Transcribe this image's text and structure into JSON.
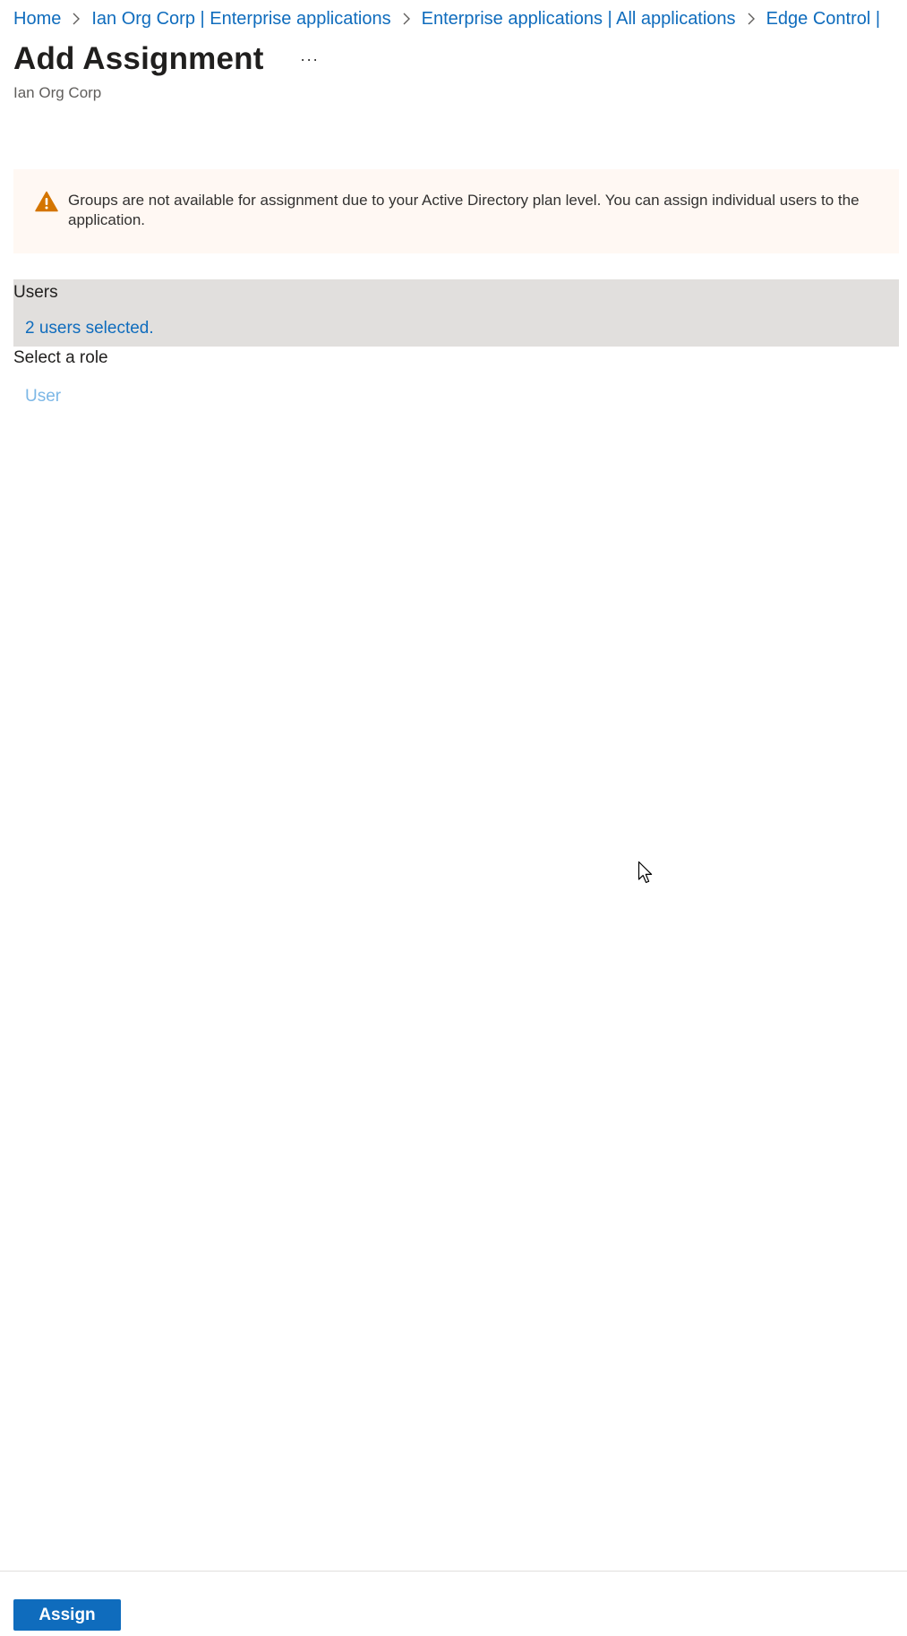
{
  "breadcrumb": {
    "items": [
      "Home",
      "Ian Org Corp | Enterprise applications",
      "Enterprise applications | All applications",
      "Edge Control |"
    ]
  },
  "header": {
    "title": "Add Assignment",
    "more_label": "···",
    "subtitle": "Ian Org Corp"
  },
  "warning": {
    "icon": "warning-triangle-icon",
    "color": "#d47500",
    "text": "Groups are not available for assignment due to your Active Directory plan level. You can assign individual users to the application."
  },
  "users": {
    "label": "Users",
    "value": "2 users selected."
  },
  "role": {
    "label": "Select a role",
    "value": "User"
  },
  "footer": {
    "assign_label": "Assign"
  },
  "colors": {
    "link": "#0f6cbd",
    "primary_button": "#0f6cbd",
    "warning_background": "#fff8f3",
    "selected_section_background": "#e1dfdd"
  }
}
